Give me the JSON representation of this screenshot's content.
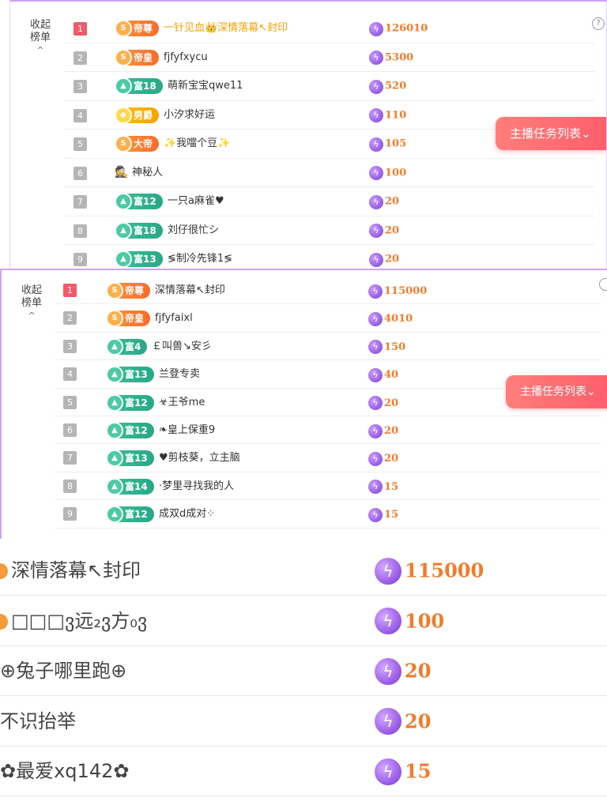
{
  "panel1": {
    "collapse_label": "收起榜单",
    "collapse_caret": "^",
    "help": "?",
    "task_button": "主播任务列表⌄",
    "rows": [
      {
        "rank": "1",
        "top": true,
        "badge": "帝尊",
        "badge_style": "orange",
        "badge_icon": "S",
        "name": "一针见血👑深情落幕↖封印",
        "hl": true,
        "score": "126010"
      },
      {
        "rank": "2",
        "top": false,
        "badge": "帝皇",
        "badge_style": "orange",
        "badge_icon": "S",
        "name": "fjfyfxycu",
        "hl": false,
        "score": "5300"
      },
      {
        "rank": "3",
        "top": false,
        "badge": "富18",
        "badge_style": "green",
        "badge_icon": "▲",
        "name": "萌新宝宝qwe11",
        "hl": false,
        "score": "520"
      },
      {
        "rank": "4",
        "top": false,
        "badge": "男爵",
        "badge_style": "gold",
        "badge_icon": "◆",
        "name": "小汐求好运",
        "hl": false,
        "score": "110"
      },
      {
        "rank": "5",
        "top": false,
        "badge": "大帝",
        "badge_style": "orange",
        "badge_icon": "S",
        "name": "✨我噹个豆✨",
        "hl": false,
        "score": "105"
      },
      {
        "rank": "6",
        "top": false,
        "badge": "",
        "badge_style": "incog",
        "badge_icon": "🕵",
        "name": "神秘人",
        "hl": false,
        "score": "100"
      },
      {
        "rank": "7",
        "top": false,
        "badge": "富12",
        "badge_style": "green",
        "badge_icon": "▲",
        "name": "一只a麻雀♥",
        "hl": false,
        "score": "20"
      },
      {
        "rank": "8",
        "top": false,
        "badge": "富18",
        "badge_style": "green",
        "badge_icon": "▲",
        "name": "刘仔很忙シ",
        "hl": false,
        "score": "20"
      },
      {
        "rank": "9",
        "top": false,
        "badge": "富13",
        "badge_style": "green",
        "badge_icon": "▲",
        "name": "≶制冷先锋1≶",
        "hl": false,
        "score": "20"
      }
    ]
  },
  "panel2": {
    "collapse_label": "收起榜单",
    "collapse_caret": "^",
    "help": "",
    "task_button": "主播任务列表⌄",
    "rows": [
      {
        "rank": "1",
        "top": true,
        "badge": "帝尊",
        "badge_style": "orange",
        "badge_icon": "S",
        "name": "深情落幕↖封印",
        "hl": false,
        "score": "115000"
      },
      {
        "rank": "2",
        "top": false,
        "badge": "帝皇",
        "badge_style": "orange",
        "badge_icon": "S",
        "name": "fjfyfaixl",
        "hl": false,
        "score": "4010"
      },
      {
        "rank": "3",
        "top": false,
        "badge": "富4",
        "badge_style": "green",
        "badge_icon": "▲",
        "name": "￡叫兽↘安彡",
        "hl": false,
        "score": "150"
      },
      {
        "rank": "4",
        "top": false,
        "badge": "富13",
        "badge_style": "green",
        "badge_icon": "▲",
        "name": "兰登专卖",
        "hl": false,
        "score": "40"
      },
      {
        "rank": "5",
        "top": false,
        "badge": "富12",
        "badge_style": "green",
        "badge_icon": "▲",
        "name": "☣王爷me",
        "hl": false,
        "score": "20"
      },
      {
        "rank": "6",
        "top": false,
        "badge": "富12",
        "badge_style": "green",
        "badge_icon": "▲",
        "name": "❧皇上保重9",
        "hl": false,
        "score": "20"
      },
      {
        "rank": "7",
        "top": false,
        "badge": "富13",
        "badge_style": "green",
        "badge_icon": "▲",
        "name": "♥剪枝葵，立主脑",
        "hl": false,
        "score": "20"
      },
      {
        "rank": "8",
        "top": false,
        "badge": "富14",
        "badge_style": "green",
        "badge_icon": "▲",
        "name": "·梦里寻找我的人",
        "hl": false,
        "score": "15"
      },
      {
        "rank": "9",
        "top": false,
        "badge": "富12",
        "badge_style": "green",
        "badge_icon": "▲",
        "name": "成双d成对⁘",
        "hl": false,
        "score": "15"
      }
    ]
  },
  "zoom": {
    "rows": [
      {
        "dot": true,
        "name": "深情落幕↖封印",
        "score": "115000"
      },
      {
        "dot": true,
        "name": "□□□ვ远₂ვ方₀ვ",
        "score": "100"
      },
      {
        "dot": false,
        "name": "⊕兔子哪里跑⊕",
        "score": "20"
      },
      {
        "dot": false,
        "name": "不识抬举",
        "score": "20"
      },
      {
        "dot": false,
        "name": "✿最爱xq142✿",
        "score": "15"
      }
    ]
  },
  "colors": {
    "accent": "#f27b2a",
    "purple_line": "#c9a6f2",
    "rank_top": "#f05a6a",
    "task_button": "#ff5a6a"
  },
  "icons": {
    "bolt": "lightning-bolt-icon",
    "collapse": "chevron-up-icon",
    "help": "question-mark-icon",
    "incognito": "incognito-icon"
  }
}
